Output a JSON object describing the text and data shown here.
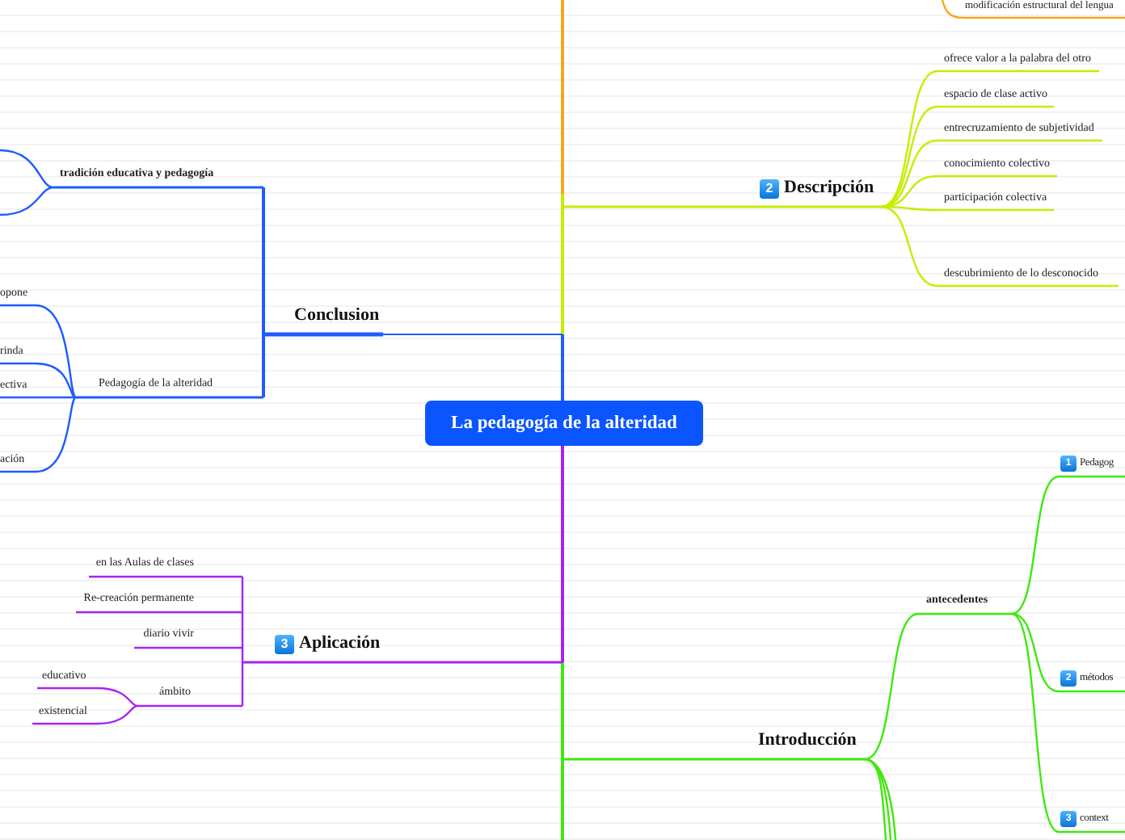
{
  "central_topic": "La pedagogía de la alteridad",
  "top_fragment": {
    "label": "modificación estructural del lengua",
    "color": "#f5a623"
  },
  "branches": [
    {
      "label": "Descripción",
      "badge": "2",
      "color": "#c8ec00",
      "children": [
        {
          "label": "ofrece valor a la palabra del otro",
          "bold": false
        },
        {
          "label": "espacio de clase activo",
          "bold": false
        },
        {
          "label": "entrecruzamiento de subjetividad",
          "bold": false
        },
        {
          "label": "conocimiento colectivo",
          "bold": false
        },
        {
          "label": "participación colectiva",
          "bold": false
        },
        {
          "label": "descubrimiento de lo desconocido",
          "bold": false
        }
      ]
    },
    {
      "label": "Conclusion",
      "color": "#1f5cff",
      "children": [
        {
          "label": "tradición educativa y pedagogía",
          "bold": true
        },
        {
          "label": "Pedagogía de la alteridad",
          "bold": false,
          "children": [
            {
              "label": "opone"
            },
            {
              "label": "rinda"
            },
            {
              "label": "ectiva"
            },
            {
              "label": "ación"
            }
          ]
        }
      ]
    },
    {
      "label": "Aplicación",
      "badge": "3",
      "color": "#a823f0",
      "children": [
        {
          "label": "en las Aulas de clases",
          "bold": false
        },
        {
          "label": "Re-creación permanente",
          "bold": false
        },
        {
          "label": "diario vivir",
          "bold": false
        },
        {
          "label": "ámbito",
          "bold": false,
          "children": [
            {
              "label": "educativo"
            },
            {
              "label": "existencial"
            }
          ]
        }
      ]
    },
    {
      "label": "Introducción",
      "color": "#3fe80f",
      "children": [
        {
          "label": "antecedentes",
          "bold": true,
          "children": [
            {
              "label": "Pedagog",
              "badge": "1"
            },
            {
              "label": "métodos",
              "badge": "2"
            },
            {
              "label": "context",
              "badge": "3"
            }
          ]
        }
      ]
    }
  ]
}
